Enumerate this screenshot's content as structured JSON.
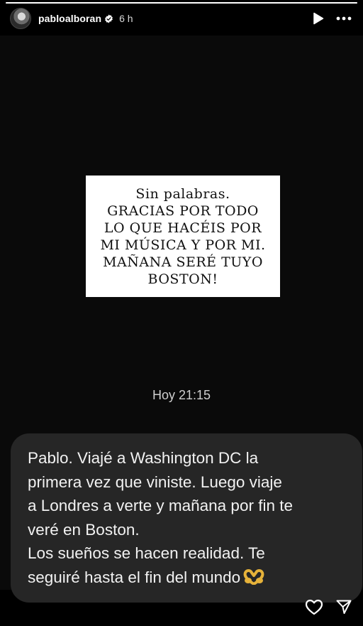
{
  "story": {
    "progress": 1.0
  },
  "header": {
    "username": "pabloalboran",
    "verified": true,
    "time_ago": "6 h",
    "icons": [
      "play-icon",
      "more-icon"
    ]
  },
  "note_card": {
    "lines": [
      "Sin palabras.",
      "GRACIAS POR TODO",
      "LO QUE HACÉIS POR",
      "MI MÚSICA Y POR MI.",
      "MAÑANA SERÉ TUYO",
      "BOSTON!"
    ]
  },
  "chat": {
    "time": "Hoy 21:15",
    "message_lines": [
      "Pablo. Viajé a Washington DC la",
      "primera vez que viniste. Luego viaje",
      "a Londres a verte y mañana por fin te",
      "veré en Boston.",
      "Los sueños se hacen realidad. Te",
      "seguiré hasta el fin del mundo"
    ],
    "emoji": "heart-hands-emoji"
  },
  "bottom_bar": {
    "icons": [
      "like-icon",
      "share-icon"
    ]
  }
}
